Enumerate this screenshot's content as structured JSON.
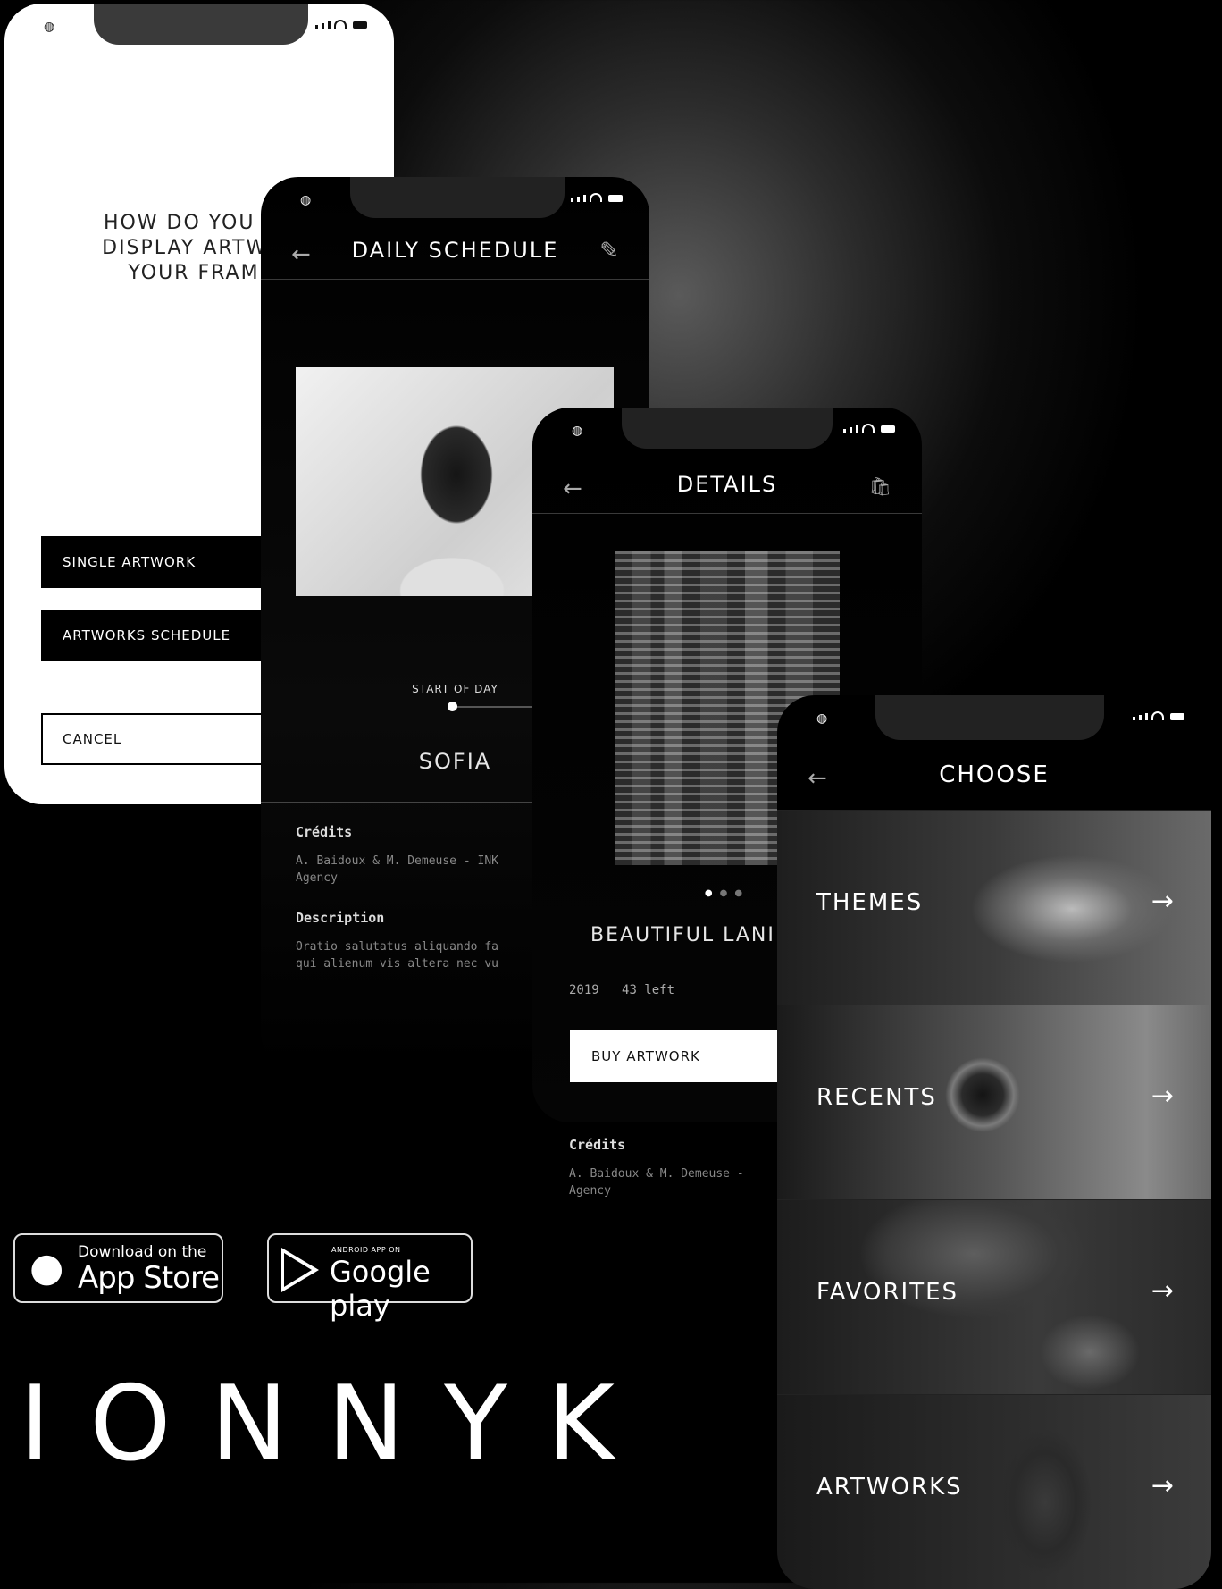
{
  "status_bar": {
    "logo_glyph": "◍"
  },
  "screen_frame": {
    "question_lines": [
      "HOW DO YOU WA",
      "DISPLAY ARTWOR",
      "YOUR FRAME"
    ],
    "buttons": {
      "single": "SINGLE ARTWORK",
      "schedule": "ARTWORKS SCHEDULE",
      "cancel": "CANCEL"
    }
  },
  "screen_schedule": {
    "title": "DAILY SCHEDULE",
    "back_icon": "←",
    "edit_icon": "✎",
    "slider_label": "START OF DAY",
    "name": "SOFIA",
    "credits_heading": "Crédits",
    "credits_text": "A. Baidoux & M. Demeuse - INK\nAgency",
    "description_heading": "Description",
    "description_text": "Oratio salutatus aliquando fa\nqui alienum vis altera nec vu"
  },
  "screen_details": {
    "title": "DETAILS",
    "back_icon": "←",
    "cart_icon": "🛍",
    "artwork_title": "BEAUTIFUL LANI",
    "year": "2019",
    "stock": "43 left",
    "buy_label": "BUY ARTWORK",
    "credits_heading": "Crédits",
    "credits_text": "A. Baidoux & M. Demeuse -\nAgency"
  },
  "screen_choose": {
    "title": "CHOOSE",
    "back_icon": "←",
    "categories": [
      {
        "label": "THEMES",
        "arrow": "→"
      },
      {
        "label": "RECENTS",
        "arrow": "→"
      },
      {
        "label": "FAVORITES",
        "arrow": "→"
      },
      {
        "label": "ARTWORKS",
        "arrow": "→"
      }
    ]
  },
  "badges": {
    "appstore": {
      "small": "Download on the",
      "big": "App Store",
      "icon": ""
    },
    "googleplay": {
      "small": "ANDROID APP ON",
      "big": "Google play"
    }
  },
  "brand": {
    "logo": "IONNYK"
  },
  "colors": {
    "background": "#000000",
    "light_screen": "#ffffff",
    "accent": "#ffffff"
  }
}
